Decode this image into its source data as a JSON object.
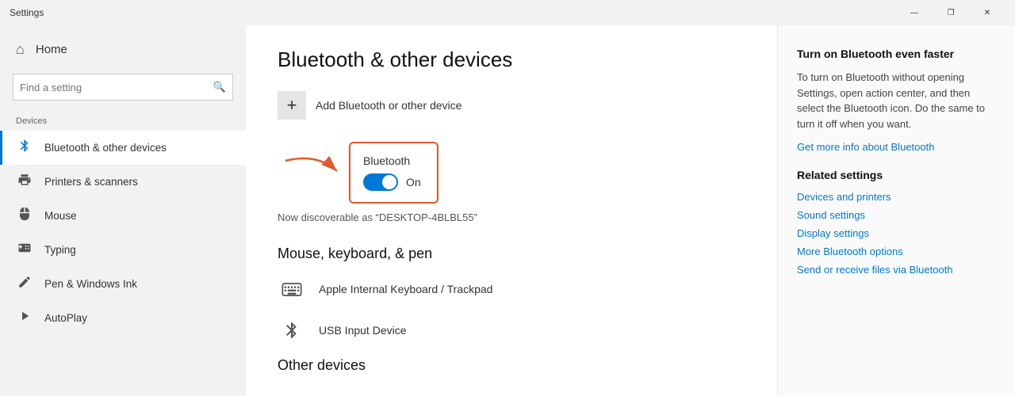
{
  "titlebar": {
    "title": "Settings",
    "minimize_label": "—",
    "restore_label": "❐",
    "close_label": "✕"
  },
  "sidebar": {
    "home_label": "Home",
    "search_placeholder": "Find a setting",
    "section_label": "Devices",
    "items": [
      {
        "id": "bluetooth",
        "label": "Bluetooth & other devices",
        "icon": "📶",
        "active": true
      },
      {
        "id": "printers",
        "label": "Printers & scanners",
        "icon": "🖨",
        "active": false
      },
      {
        "id": "mouse",
        "label": "Mouse",
        "icon": "🖱",
        "active": false
      },
      {
        "id": "typing",
        "label": "Typing",
        "icon": "⌨",
        "active": false
      },
      {
        "id": "pen",
        "label": "Pen & Windows Ink",
        "icon": "✒",
        "active": false
      },
      {
        "id": "autoplay",
        "label": "AutoPlay",
        "icon": "▶",
        "active": false
      }
    ]
  },
  "main": {
    "page_title": "Bluetooth & other devices",
    "add_device_label": "Add Bluetooth or other device",
    "bluetooth_label": "Bluetooth",
    "bluetooth_on": "On",
    "discoverable_text": "Now discoverable as “DESKTOP-4BLBL55”",
    "mouse_section_heading": "Mouse, keyboard, & pen",
    "devices": [
      {
        "id": "keyboard",
        "label": "Apple Internal Keyboard / Trackpad",
        "icon": "⌨"
      },
      {
        "id": "usb",
        "label": "USB Input Device",
        "icon": "✱"
      }
    ],
    "other_devices_heading": "Other devices"
  },
  "right_panel": {
    "faster_title": "Turn on Bluetooth even faster",
    "faster_body": "To turn on Bluetooth without opening Settings, open action center, and then select the Bluetooth icon. Do the same to turn it off when you want.",
    "get_more_link": "Get more info about Bluetooth",
    "related_title": "Related settings",
    "related_links": [
      "Devices and printers",
      "Sound settings",
      "Display settings",
      "More Bluetooth options",
      "Send or receive files via Bluetooth"
    ]
  }
}
